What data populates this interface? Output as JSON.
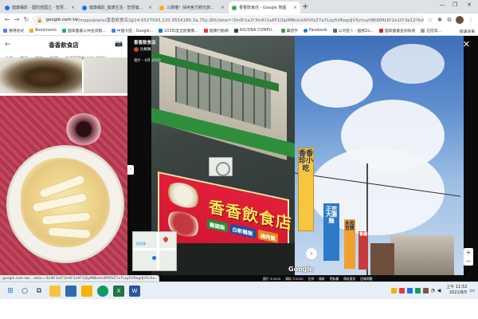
{
  "tabs": [
    {
      "label": "健康攝影 - 國防部國立 - 智慧健康行動",
      "active": false,
      "fav_color": "#1a73e8"
    },
    {
      "label": "健康攝影_健康生活 - 智慧健康行動",
      "active": false,
      "fav_color": "#1a73e8"
    },
    {
      "label": "三層樓！採用官方觀光旅遊網",
      "active": false,
      "fav_color": "#f9ab00"
    },
    {
      "label": "香香飲食店 - Google 地圖",
      "active": true,
      "fav_color": "#34a853"
    }
  ],
  "address": {
    "host": "google.com.tw",
    "path": "/maps/place/香香飲食店/@24.6527593,120.9554186,3a,75y,90t/data=!3m8!1e2!3m6!1sAF1QipMBksUs6fVfzZ7a7Lxp5V6egdjV5chuytBKWMLR!2e10!3e12!6shttps:%2F%"
  },
  "bookmarks": [
    "應用程式",
    "Bookmarks",
    "國家圖書公共查詢服...",
    "中國大陸 - Google...",
    "103年度全民健康...",
    "健康行動網",
    "ASUSTeK COMPU...",
    "藥證字",
    "Facebook",
    "公司登入 - 國務Zo...",
    "國家圖書查詢系統",
    "在前常..."
  ],
  "bookmarks_right": "閱讀清單",
  "left_panel": {
    "title": "香香飲食店",
    "tabs": [
      "全部",
      "菜單",
      "餐飲",
      "氛圍",
      "街景服務和 360 度相片"
    ]
  },
  "streetview": {
    "place_name": "香香飲食店",
    "author": "比鮮舞",
    "date": "相片 - 8月 2020",
    "sign_main": "香香飲食店",
    "sign_chips": [
      "雞腿飯",
      "白斬雞飯",
      "滷肉飯"
    ],
    "vsign1": "香香珍小吃",
    "vsign2": "正宗大腸麵",
    "vsign3": "永和豆漿",
    "vsign4": "餐廳",
    "minimap_label": "拉拉角",
    "google_logo": "Google",
    "footer": [
      "圖片 ©2020",
      "資料 ©2020",
      "台灣",
      "條款",
      "隱私權",
      "傳送意見",
      "回報問題"
    ]
  },
  "status_url": "google.com.tw/...data=!3m8!1e2!3m6!1sAF1QipMBksUs6fVfzZ7a7Lxp5V6egdjV5chuyt...",
  "taskbar": {
    "time": "上午 11:52",
    "date": "2021/8/5"
  }
}
